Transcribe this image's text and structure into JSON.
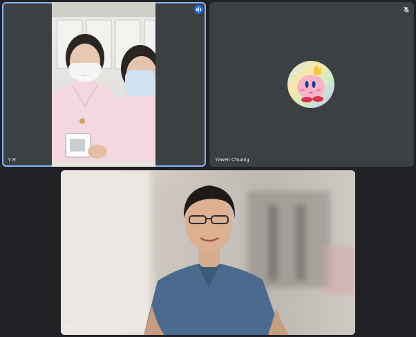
{
  "participants": [
    {
      "name": "Y R",
      "speaking": true,
      "muted": false
    },
    {
      "name": "Yawen Chuang",
      "speaking": false,
      "muted": true
    },
    {
      "name": "",
      "speaking": false,
      "muted": false
    }
  ],
  "colors": {
    "background": "#202124",
    "tile": "#3c4043",
    "active_border": "#8ab4f8",
    "speaking_badge": "#1a73e8"
  },
  "icons": {
    "speaking": "audio-wave-icon",
    "muted": "mic-off-icon",
    "tile_corner": "options-icon"
  }
}
